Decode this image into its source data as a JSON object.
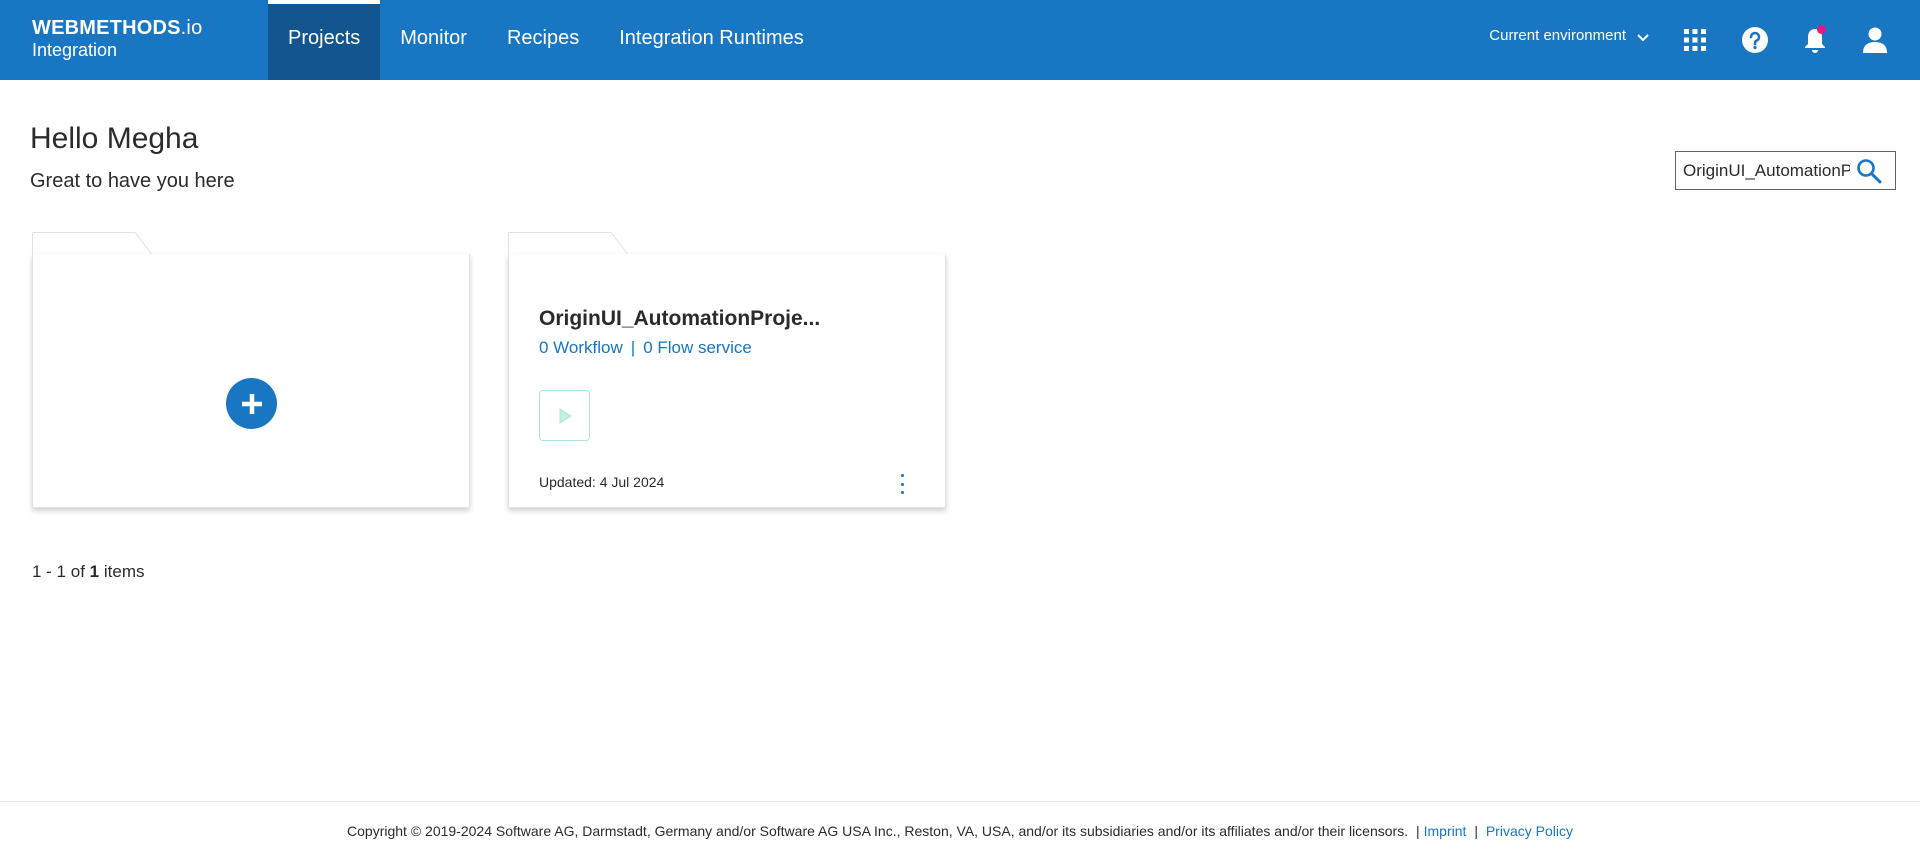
{
  "header": {
    "brand_main": "WEBMETHODS",
    "brand_io": ".io",
    "brand_sub": "Integration",
    "tabs": [
      {
        "label": "Projects",
        "active": true
      },
      {
        "label": "Monitor",
        "active": false
      },
      {
        "label": "Recipes",
        "active": false
      },
      {
        "label": "Integration Runtimes",
        "active": false
      }
    ],
    "environment_label": "Current environment",
    "icons": [
      "apps-grid-icon",
      "help-icon",
      "bell-icon",
      "user-icon"
    ],
    "colors": {
      "bar": "#1976c2",
      "active_tab": "#12558f",
      "notification_dot": "#e8177d"
    }
  },
  "greeting": {
    "title": "Hello Megha",
    "subtitle": "Great to have you here"
  },
  "search": {
    "value": "OriginUI_AutomationProject",
    "icon": "search-icon"
  },
  "cards": {
    "add_icon": "plus-icon",
    "project": {
      "title": "OriginUI_AutomationProje...",
      "workflows": "0 Workflow",
      "separator": "|",
      "flow_services": "0 Flow service",
      "run_icon": "play-icon",
      "updated": "Updated: 4 Jul 2024",
      "menu_icon": "kebab-menu-icon"
    }
  },
  "pagination": {
    "range": "1 - 1 of",
    "total": "1",
    "suffix": "items"
  },
  "footer": {
    "copyright": "Copyright © 2019-2024 Software AG, Darmstadt, Germany and/or Software AG USA Inc., Reston, VA, USA, and/or its subsidiaries and/or its affiliates and/or their licensors.",
    "separator": "|",
    "imprint": "Imprint",
    "privacy": "Privacy Policy"
  }
}
